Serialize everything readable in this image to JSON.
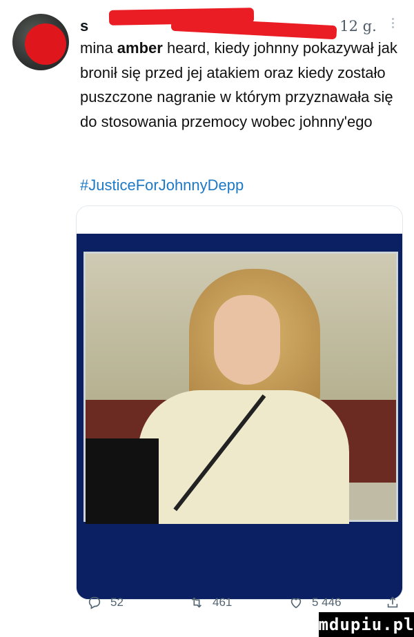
{
  "tweet": {
    "author_initial": "s",
    "time": "12 g.",
    "text_bold": "amber",
    "text_prefix": "mina ",
    "text_rest": " heard, kiedy johnny pokazywał jak bronił się przed jej atakiem oraz kiedy zostało puszczone nagranie w którym przyznawała się do stosowania przemocy wobec johnny'ego",
    "hashtag": "#JusticeForJohnnyDepp"
  },
  "actions": {
    "replies": "52",
    "retweets": "461",
    "likes": "5 446"
  },
  "watermark": "mdupiu.pl",
  "icons": [
    "avatar",
    "more-icon",
    "reply-icon",
    "retweet-icon",
    "like-icon",
    "share-icon"
  ],
  "colors": {
    "redaction": "#ea1c24",
    "hashtag": "#1d79c5",
    "muted": "#536471"
  }
}
